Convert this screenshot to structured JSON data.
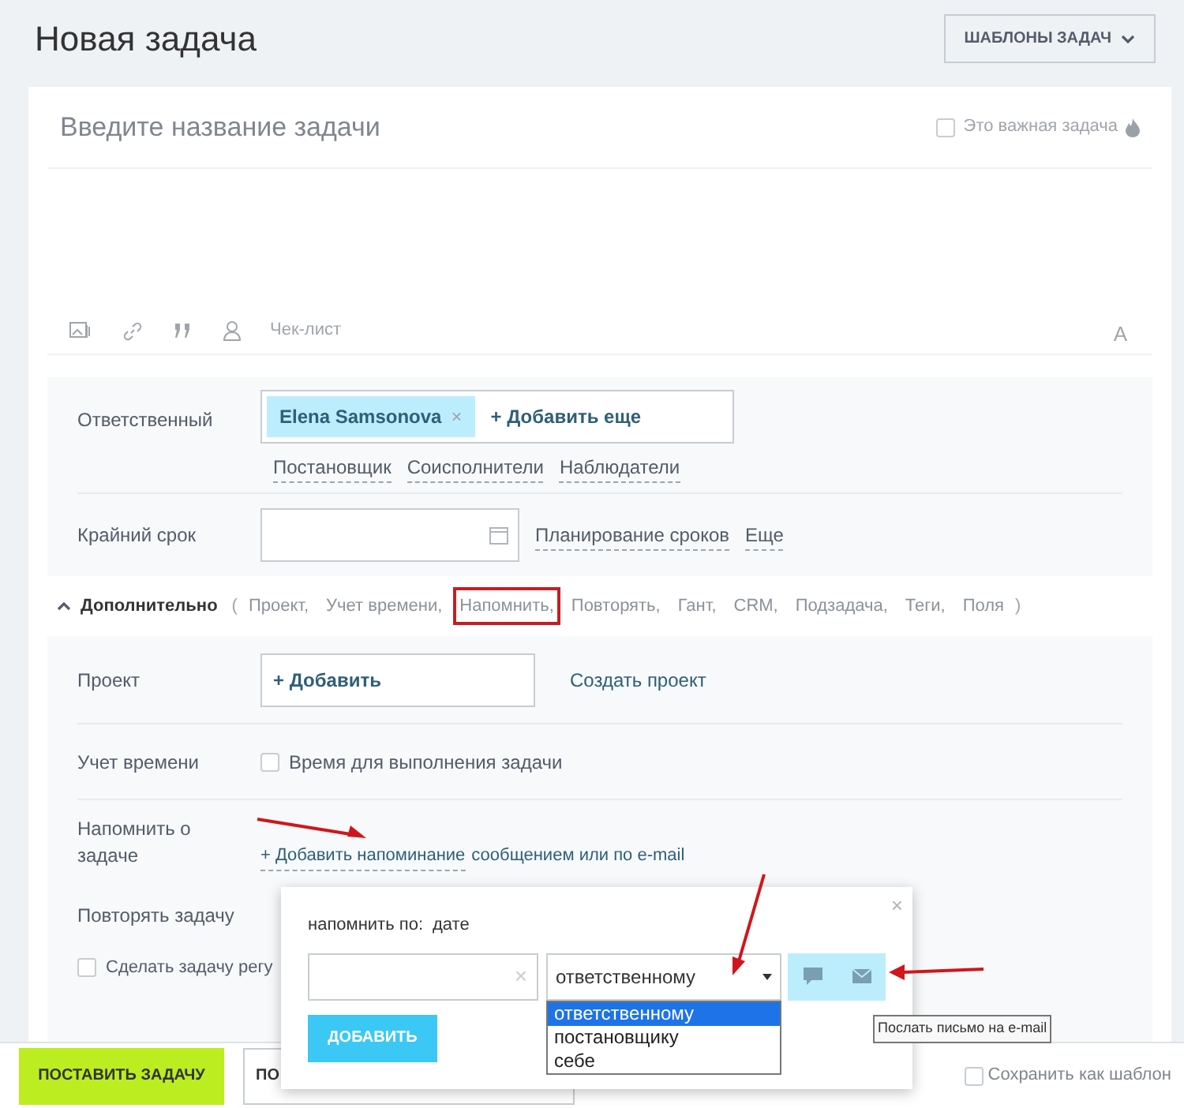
{
  "page_title": "Новая задача",
  "templates_button": "ШАБЛОНЫ ЗАДАЧ",
  "task_title": {
    "placeholder": "Введите название задачи"
  },
  "important": {
    "label": "Это важная задача",
    "checked": false
  },
  "toolbar": {
    "checklist": "Чек-лист",
    "font_button": "A"
  },
  "responsible": {
    "label": "Ответственный",
    "tags": [
      "Elena Samsonova"
    ],
    "tag_remove": "×",
    "add_more": "+ Добавить еще",
    "roles": [
      "Постановщик",
      "Соисполнители",
      "Наблюдатели"
    ]
  },
  "deadline": {
    "label": "Крайний срок",
    "links": [
      "Планирование сроков",
      "Еще"
    ]
  },
  "additional": {
    "title": "Дополнительно",
    "expanded": true,
    "open_paren": "(",
    "close_paren": ")",
    "items": [
      {
        "label": "Проект,",
        "highlighted": false
      },
      {
        "label": "Учет времени,",
        "highlighted": false
      },
      {
        "label": "Напомнить,",
        "highlighted": true
      },
      {
        "label": "Повторять,",
        "highlighted": false
      },
      {
        "label": "Гант,",
        "highlighted": false
      },
      {
        "label": "CRM,",
        "highlighted": false
      },
      {
        "label": "Подзадача,",
        "highlighted": false
      },
      {
        "label": "Теги,",
        "highlighted": false
      },
      {
        "label": "Поля",
        "highlighted": false
      }
    ]
  },
  "project": {
    "label": "Проект",
    "add": "+ Добавить",
    "create": "Создать проект"
  },
  "time_tracking": {
    "label": "Учет времени",
    "checkbox": "Время для выполнения задачи",
    "checked": false
  },
  "reminder": {
    "label": "Напомнить о задаче",
    "add_link": "+ Добавить напоминание",
    "rest": "сообщением или по e-mail"
  },
  "repeat": {
    "label": "Повторять задачу",
    "regular": {
      "label": "Сделать задачу регу",
      "checked": false
    }
  },
  "footer": {
    "submit": "ПОСТАВИТЬ ЗАДАЧУ",
    "second": "ПО",
    "save_template": {
      "label": "Сохранить как шаблон",
      "checked": false
    }
  },
  "popup": {
    "close": "×",
    "remind_by_label": "напомнить по:",
    "remind_by_value": "дате",
    "date_clear": "×",
    "recipient": {
      "value": "ответственному",
      "options": [
        {
          "label": "ответственному",
          "selected": true
        },
        {
          "label": "постановщику",
          "selected": false
        },
        {
          "label": "себе",
          "selected": false
        }
      ]
    },
    "channels": [
      {
        "kind": "message"
      },
      {
        "kind": "email"
      }
    ],
    "add_button": "ДОБАВИТЬ",
    "tooltip": "Послать письмо на e-mail"
  }
}
